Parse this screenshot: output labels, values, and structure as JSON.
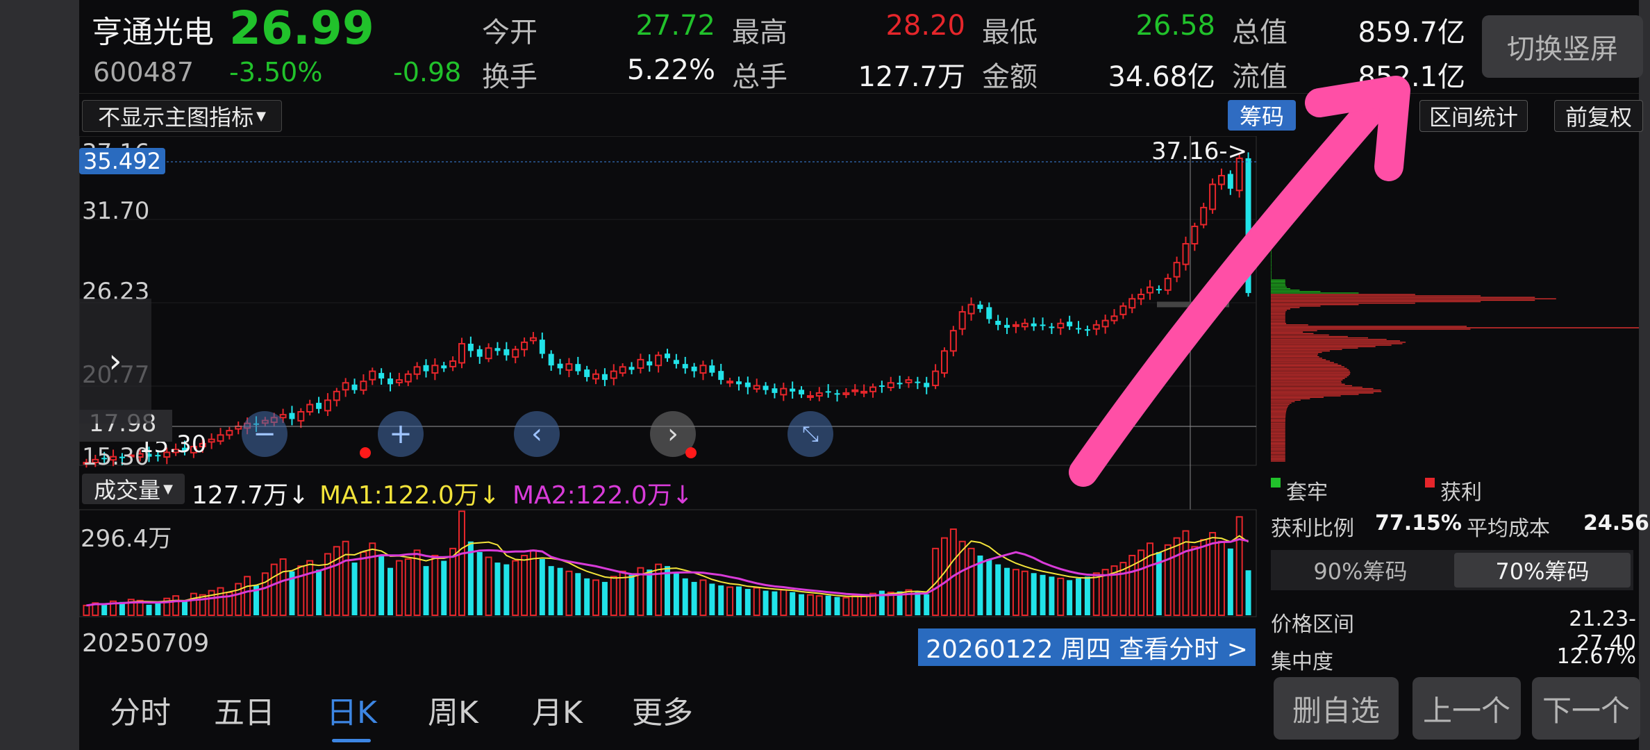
{
  "header": {
    "name": "亨通光电",
    "price": "26.99",
    "code": "600487",
    "change_pct": "-3.50%",
    "change": "-0.98",
    "stats": [
      {
        "label": "今开",
        "value": "27.72",
        "color": "green"
      },
      {
        "label": "最高",
        "value": "28.20",
        "color": "red"
      },
      {
        "label": "最低",
        "value": "26.58",
        "color": "green"
      },
      {
        "label": "总值",
        "value": "859.7亿",
        "color": "white"
      },
      {
        "label": "换手",
        "value": "5.22%",
        "color": "white"
      },
      {
        "label": "总手",
        "value": "127.7万",
        "color": "white"
      },
      {
        "label": "金额",
        "value": "34.68亿",
        "color": "white"
      },
      {
        "label": "流值",
        "value": "852.1亿",
        "color": "white"
      }
    ],
    "switch_label": "切换竖屏"
  },
  "toolbar": {
    "indicator_select": "不显示主图指标",
    "chips_label": "筹码",
    "range_stats_label": "区间统计",
    "adjust_label": "前复权"
  },
  "kline": {
    "price_labels": [
      "37.16",
      "31.70",
      "26.23",
      "20.77",
      "17.98",
      "15.30"
    ],
    "crosshair_value": "35.492",
    "high_marker": "37.16->",
    "low_marker": "15.30"
  },
  "volume": {
    "indicator_select": "成交量",
    "vol": "127.7万↓",
    "ma1": "MA1:122.0万↓",
    "ma2": "MA2:122.0万↓",
    "max_label": "296.4万",
    "start_date": "20250709",
    "detail_date": "20260122 周四 查看分时 >"
  },
  "chips": {
    "legend_trapped": "套牢",
    "legend_profit": "获利",
    "profit_ratio_label": "获利比例",
    "profit_ratio": "77.15%",
    "avg_cost_label": "平均成本",
    "avg_cost": "24.56",
    "tab_90": "90%筹码",
    "tab_70": "70%筹码",
    "price_range_label": "价格区间",
    "price_range": "21.23-27.40",
    "concentration_label": "集中度",
    "concentration": "12.67%"
  },
  "tabs": [
    "分时",
    "五日",
    "日K",
    "周K",
    "月K",
    "更多"
  ],
  "active_tab": "日K",
  "bottom_buttons": {
    "delete": "删自选",
    "prev": "上一个",
    "next": "下一个"
  },
  "colors": {
    "up": "#e6262b",
    "down": "#21e3e9",
    "green": "#21c22b",
    "accent": "#3d86e3",
    "ma1": "#f2e33a",
    "ma2": "#d83bd8",
    "annotation": "#ff4fa6"
  },
  "chart_data": {
    "type": "candlestick",
    "closes": [
      15.3,
      15.5,
      15.6,
      15.7,
      15.6,
      15.8,
      15.9,
      15.7,
      15.8,
      16.0,
      16.2,
      16.1,
      16.4,
      16.6,
      16.9,
      17.2,
      17.5,
      17.8,
      18.0,
      17.9,
      18.2,
      18.4,
      18.6,
      18.3,
      18.8,
      19.3,
      19.0,
      19.6,
      20.2,
      20.8,
      20.3,
      20.9,
      21.6,
      21.1,
      20.7,
      21.0,
      21.4,
      21.9,
      21.6,
      22.0,
      21.8,
      22.3,
      23.5,
      23.0,
      22.6,
      23.2,
      23.0,
      22.7,
      23.1,
      23.6,
      23.9,
      22.8,
      22.0,
      21.8,
      22.1,
      21.6,
      21.2,
      21.4,
      21.0,
      21.6,
      21.9,
      21.7,
      22.4,
      22.0,
      22.7,
      22.5,
      22.1,
      21.8,
      21.6,
      22.0,
      21.5,
      21.0,
      20.9,
      20.7,
      20.5,
      20.6,
      20.3,
      20.1,
      20.4,
      20.2,
      20.0,
      19.9,
      20.1,
      20.2,
      20.0,
      20.1,
      20.3,
      20.2,
      20.5,
      20.6,
      20.8,
      20.7,
      21.0,
      20.8,
      20.5,
      21.6,
      23.0,
      24.4,
      25.7,
      26.2,
      25.9,
      25.2,
      24.8,
      24.6,
      24.8,
      24.9,
      24.7,
      24.8,
      24.6,
      24.9,
      24.7,
      24.5,
      24.4,
      24.8,
      25.1,
      25.4,
      26.1,
      26.6,
      26.9,
      27.4,
      27.2,
      28.0,
      29.1,
      30.4,
      31.6,
      32.9,
      34.5,
      35.1,
      34.2,
      36.3,
      27.0
    ],
    "volumes": [
      0.28,
      0.35,
      0.32,
      0.4,
      0.38,
      0.45,
      0.42,
      0.3,
      0.36,
      0.48,
      0.55,
      0.4,
      0.62,
      0.58,
      0.7,
      0.78,
      0.65,
      0.9,
      1.1,
      0.85,
      1.2,
      1.45,
      1.6,
      1.25,
      1.4,
      1.55,
      1.3,
      1.75,
      1.95,
      2.1,
      1.5,
      1.8,
      2.05,
      1.7,
      1.35,
      1.55,
      1.6,
      1.85,
      1.4,
      1.7,
      1.55,
      1.9,
      2.96,
      2.1,
      1.8,
      1.65,
      1.5,
      1.45,
      1.55,
      1.7,
      1.85,
      1.6,
      1.4,
      1.35,
      1.25,
      1.2,
      1.05,
      1.0,
      0.95,
      1.1,
      1.25,
      1.15,
      1.35,
      1.3,
      1.45,
      1.4,
      1.2,
      1.05,
      0.95,
      1.0,
      0.9,
      0.85,
      0.8,
      0.82,
      0.75,
      0.78,
      0.7,
      0.68,
      0.72,
      0.66,
      0.6,
      0.58,
      0.55,
      0.56,
      0.52,
      0.5,
      0.55,
      0.54,
      0.62,
      0.7,
      0.65,
      0.68,
      0.72,
      0.66,
      0.6,
      1.9,
      2.2,
      2.45,
      2.1,
      1.9,
      1.7,
      1.6,
      1.45,
      1.35,
      1.3,
      1.25,
      1.2,
      1.15,
      1.1,
      1.05,
      1.0,
      1.05,
      1.1,
      1.2,
      1.3,
      1.4,
      1.5,
      1.7,
      1.85,
      2.05,
      1.8,
      2.0,
      2.2,
      2.4,
      1.95,
      2.15,
      2.35,
      2.1,
      1.9,
      2.8,
      1.28
    ],
    "chip_profile": {
      "green_peak": {
        "price": 26.6,
        "weight": 0.75
      },
      "red_peak": {
        "price": 24.6,
        "weight": 1.0
      }
    },
    "ylim": [
      15.3,
      37.16
    ],
    "volume_max": "296.4万"
  }
}
